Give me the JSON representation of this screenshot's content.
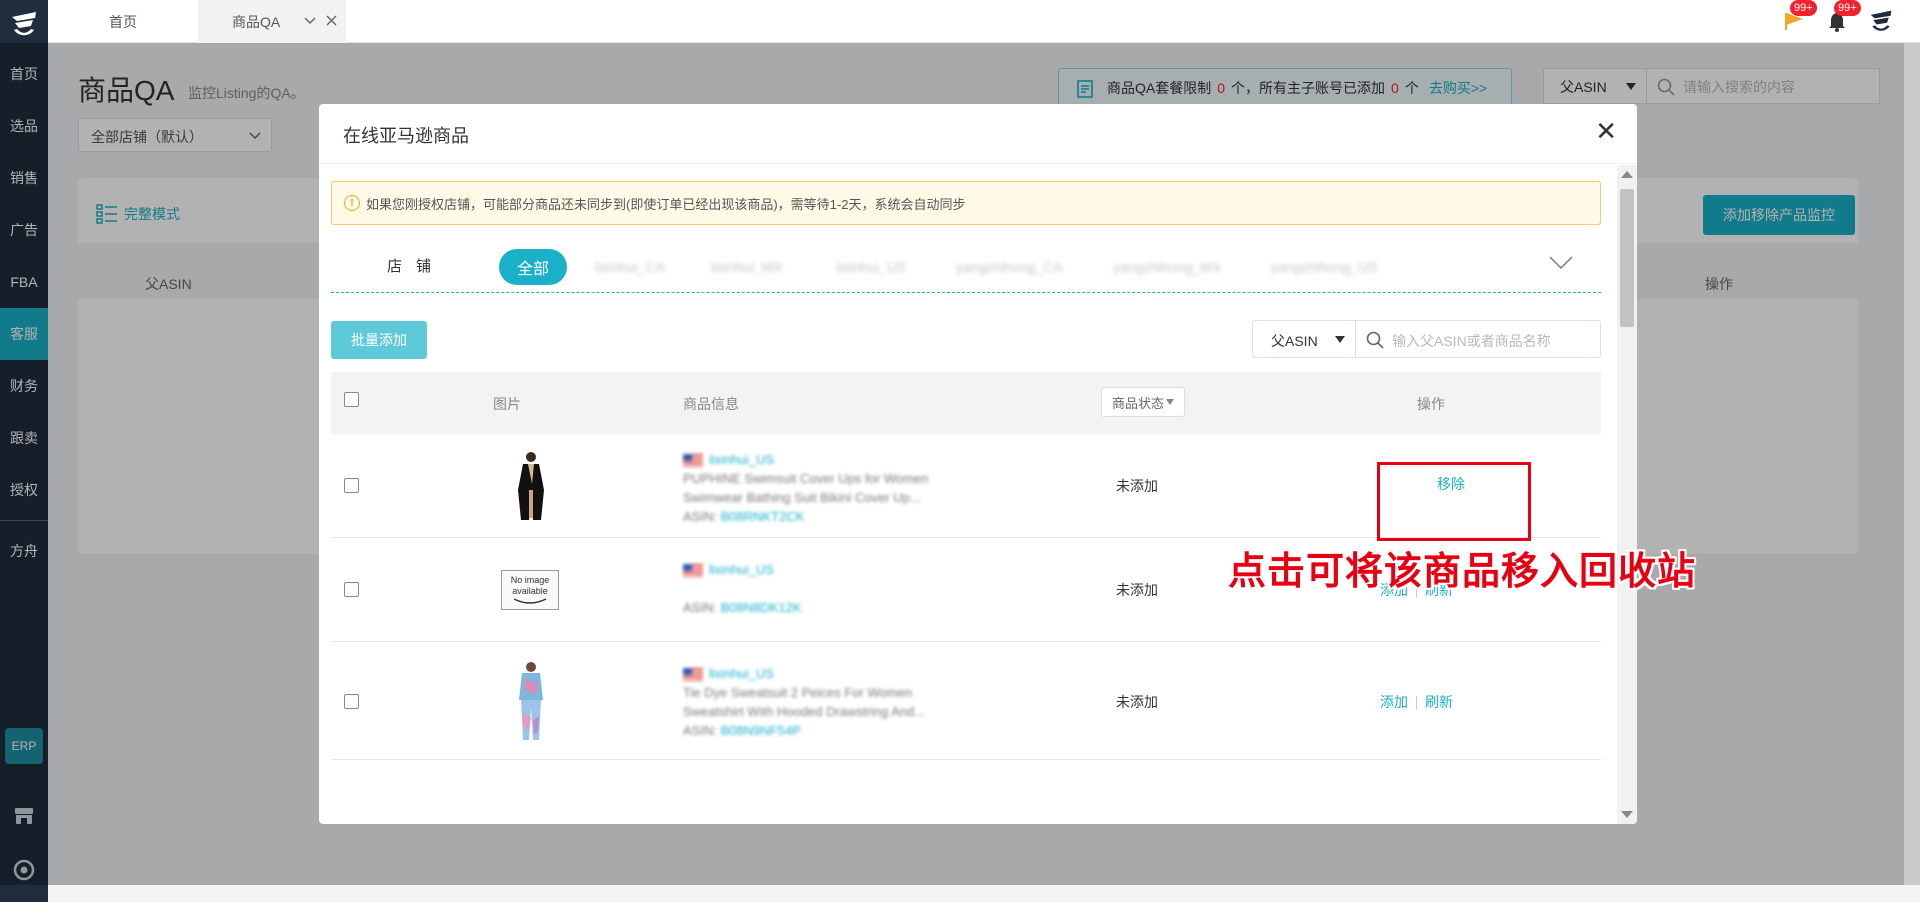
{
  "sidebar": {
    "items": [
      {
        "label": "首页"
      },
      {
        "label": "选品"
      },
      {
        "label": "销售"
      },
      {
        "label": "广告"
      },
      {
        "label": "FBA"
      },
      {
        "label": "客服"
      },
      {
        "label": "财务"
      },
      {
        "label": "跟卖"
      },
      {
        "label": "授权"
      },
      {
        "label": "方舟"
      }
    ],
    "erp_label": "ERP",
    "active_item": "客服"
  },
  "tabs": [
    {
      "label": "首页"
    },
    {
      "label": "商品QA"
    }
  ],
  "header": {
    "flag_badge": "99+",
    "bell_badge": "99+"
  },
  "page": {
    "title": "商品QA",
    "subtitle": "监控Listing的QA。",
    "store_select": "全部店铺（默认）",
    "quota": {
      "prefix": "商品QA套餐限制",
      "limit": "0",
      "middle": "个，所有主子账号已添加",
      "added": "0",
      "suffix": "个",
      "link": "去购买>>"
    },
    "asin_select": "父ASIN",
    "search_placeholder": "请输入搜索的内容",
    "full_mode_label": "完整模式",
    "monitor_button": "添加移除产品监控",
    "columns": {
      "parent_asin": "父ASIN",
      "ops": "操作"
    }
  },
  "modal": {
    "title": "在线亚马逊商品",
    "notice": "如果您刚授权店铺，可能部分商品还未同步到(即使订单已经出现该商品)，需等待1-2天，系统会自动同步",
    "store_label": "店铺",
    "stores": [
      "全部",
      "lixinhui_CA",
      "lixinhui_MX",
      "lixinhui_US",
      "yangzhihong_CA",
      "yangzhihong_MX",
      "yangzhihong_US"
    ],
    "batch_add": "批量添加",
    "asin_select": "父ASIN",
    "search_placeholder": "输入父ASIN或者商品名称",
    "columns": {
      "image": "图片",
      "info": "商品信息",
      "status": "商品状态",
      "ops": "操作"
    },
    "rows": [
      {
        "store": "lixinhui_US",
        "title_line1": "PUPHINE Swimsuit Cover Ups for Women",
        "title_line2": "Swimwear Bathing Suit Bikini Cover Up...",
        "asin_label": "ASIN:",
        "asin": "B08RNKT2CK",
        "status": "未添加",
        "action": "移除",
        "image": "black-robe"
      },
      {
        "store": "lixinhui_US",
        "title_line1": "",
        "title_line2": "",
        "asin_label": "ASIN:",
        "asin": "B08N8DK12K",
        "status": "未添加",
        "add": "添加",
        "refresh": "刷新",
        "image": "no-image"
      },
      {
        "store": "lixinhui_US",
        "title_line1": "Tie Dye Sweatsuit 2 Peices For Women",
        "title_line2": "Sweatshirt With Hooded Drawstring And...",
        "asin_label": "ASIN:",
        "asin": "B08N9NF54P",
        "status": "未添加",
        "add": "添加",
        "refresh": "刷新",
        "image": "tie-dye-set"
      }
    ],
    "no_image_text_1": "No image",
    "no_image_text_2": "available"
  },
  "annotation": {
    "text": "点击可将该商品移入回收站",
    "color": "#e60012"
  },
  "colors": {
    "accent": "#1ab0c7",
    "sidebar_bg": "#1f2d3d",
    "alert_red": "#f5222d"
  }
}
